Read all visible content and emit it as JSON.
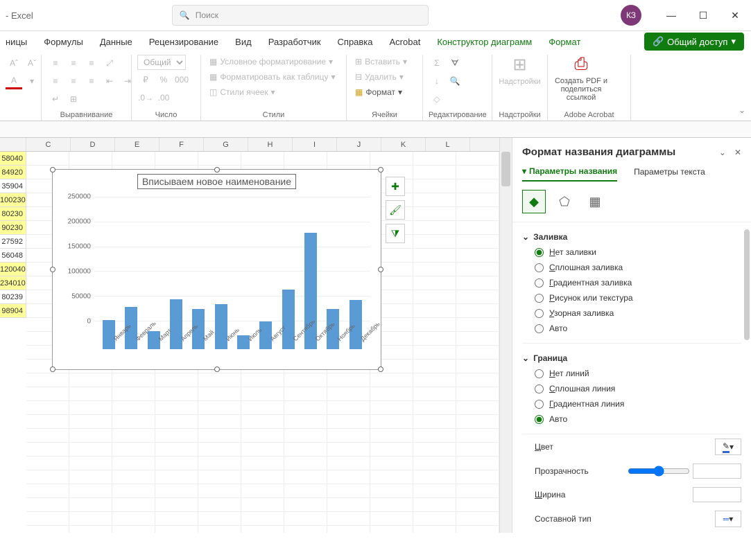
{
  "titlebar": {
    "app": "- Excel",
    "search_placeholder": "Поиск",
    "user_initials": "КЗ"
  },
  "tabs": {
    "items": [
      "ницы",
      "Формулы",
      "Данные",
      "Рецензирование",
      "Вид",
      "Разработчик",
      "Справка",
      "Acrobat",
      "Конструктор диаграмм",
      "Формат"
    ],
    "active_indices": [
      8,
      9
    ],
    "share": "Общий доступ"
  },
  "ribbon": {
    "alignment": {
      "label": "Выравнивание"
    },
    "number": {
      "label": "Число",
      "format": "Общий"
    },
    "styles": {
      "label": "Стили",
      "cond_format": "Условное форматирование",
      "as_table": "Форматировать как таблицу",
      "cell_styles": "Стили ячеек"
    },
    "cells": {
      "label": "Ячейки",
      "insert": "Вставить",
      "delete": "Удалить",
      "format": "Формат"
    },
    "editing": {
      "label": "Редактирование"
    },
    "addins": {
      "label": "Надстройки",
      "btn": "Надстройки"
    },
    "acrobat": {
      "label": "Adobe Acrobat",
      "create_pdf": "Создать PDF и поделиться ссылкой"
    }
  },
  "columns": [
    "",
    "C",
    "D",
    "E",
    "F",
    "G",
    "H",
    "I",
    "J",
    "K",
    "L"
  ],
  "data_cells": [
    {
      "v": "58040",
      "y": true
    },
    {
      "v": "84920",
      "y": true
    },
    {
      "v": "35904",
      "y": false
    },
    {
      "v": "100230",
      "y": true
    },
    {
      "v": "80230",
      "y": true
    },
    {
      "v": "90230",
      "y": true
    },
    {
      "v": "27592",
      "y": false
    },
    {
      "v": "56048",
      "y": false
    },
    {
      "v": "120040",
      "y": true
    },
    {
      "v": "234010",
      "y": true
    },
    {
      "v": "80239",
      "y": false
    },
    {
      "v": "98904",
      "y": true
    }
  ],
  "chart_data": {
    "type": "bar",
    "title": "Вписываем новое наименование",
    "categories": [
      "Январь",
      "Февраль",
      "Март",
      "Апрель",
      "Май",
      "Июнь",
      "Июль",
      "Август",
      "Сентябрь",
      "Октябрь",
      "Ноябрь",
      "Декабрь"
    ],
    "values": [
      58040,
      84920,
      35904,
      100230,
      80230,
      90230,
      27592,
      56048,
      120040,
      234010,
      80239,
      98904
    ],
    "ylim": [
      0,
      250000
    ],
    "y_ticks": [
      0,
      50000,
      100000,
      150000,
      200000,
      250000
    ]
  },
  "pane": {
    "title": "Формат названия диаграммы",
    "tab_params": "Параметры названия",
    "tab_text": "Параметры текста",
    "fill": {
      "head": "Заливка",
      "none": "Нет заливки",
      "solid": "Сплошная заливка",
      "gradient": "Градиентная заливка",
      "picture": "Рисунок или текстура",
      "pattern": "Узорная заливка",
      "auto": "Авто"
    },
    "border": {
      "head": "Граница",
      "none": "Нет линий",
      "solid": "Сплошная линия",
      "gradient": "Градиентная линия",
      "auto": "Авто"
    },
    "color": "Цвет",
    "transparency": "Прозрачность",
    "width": "Ширина",
    "compound": "Составной тип"
  }
}
